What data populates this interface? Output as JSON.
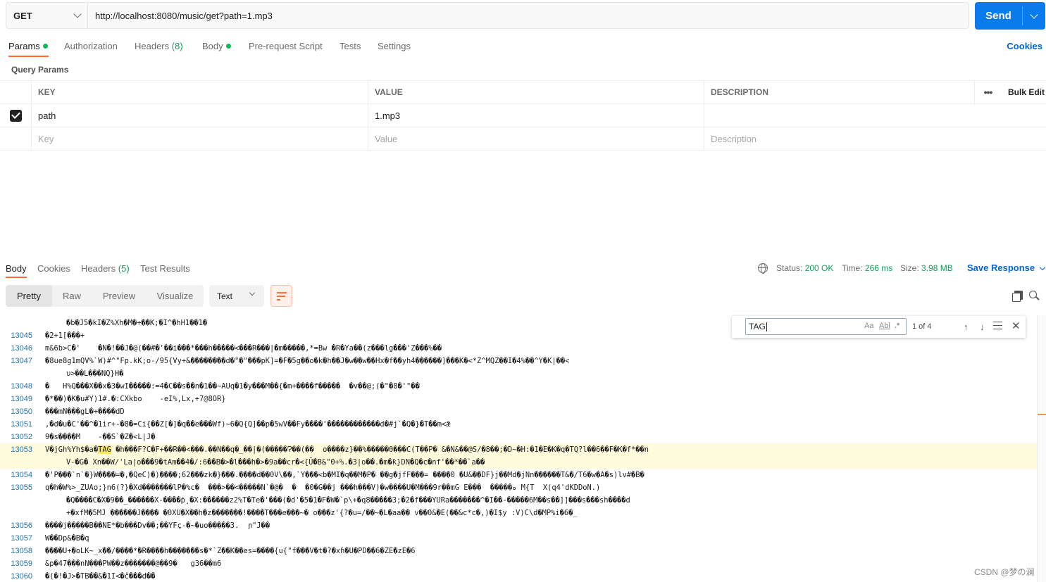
{
  "request": {
    "method": "GET",
    "url": "http://localhost:8080/music/get?path=1.mp3",
    "send_label": "Send"
  },
  "tabs": {
    "params": "Params",
    "authorization": "Authorization",
    "headers": "Headers",
    "headers_count": "(8)",
    "body": "Body",
    "pre_request": "Pre-request Script",
    "tests": "Tests",
    "settings": "Settings",
    "cookies": "Cookies"
  },
  "query_params": {
    "title": "Query Params",
    "headers": {
      "key": "KEY",
      "value": "VALUE",
      "description": "DESCRIPTION",
      "bulk_edit": "Bulk Edit"
    },
    "rows": [
      {
        "key": "path",
        "value": "1.mp3",
        "checked": true
      }
    ],
    "placeholders": {
      "key": "Key",
      "value": "Value",
      "description": "Description"
    }
  },
  "response": {
    "tabs": {
      "body": "Body",
      "cookies": "Cookies",
      "headers": "Headers",
      "headers_count": "(5)",
      "test_results": "Test Results"
    },
    "status_label": "Status:",
    "status_value": "200 OK",
    "time_label": "Time:",
    "time_value": "266 ms",
    "size_label": "Size:",
    "size_value": "3.98 MB",
    "save_label": "Save Response",
    "formats": {
      "pretty": "Pretty",
      "raw": "Raw",
      "preview": "Preview",
      "visualize": "Visualize"
    },
    "type_select": "Text"
  },
  "find": {
    "query": "TAG",
    "match_case": "Aa",
    "whole_word": "Abl",
    "regex": ".*",
    "count": "1 of 4"
  },
  "code_lines": [
    {
      "num": "",
      "text": "�b�J5�kI�Z%Xh�M�+��K;�I^�hH1��1�",
      "cont": true
    },
    {
      "num": "13045",
      "text": "�2+1[���+"
    },
    {
      "num": "13046",
      "text": "m&6b>C�'    �N�!��J�@(��#�'��i���*���h�����<���R���|�m�����,*=Bw �R�Ya��(z���lg���'Z���%��"
    },
    {
      "num": "13047",
      "text": "�8ue8g1mQV%`W)#^\"Fp.kK;o-/95{Vy+&��������d�\"�\"���pK]=�F�5g��o�k�h��J�w��w��Hx�f��yh4������]���K�<*Z^MQZ��I�4%��^Y�K|��<"
    },
    {
      "num": "",
      "text": "υ>��L���NQ}H�",
      "cont": true
    },
    {
      "num": "13048",
      "text": "�   H%Q���X��x�3�wI�����:=4�C��s��n�1��~AUq�1�y���M��{�m+����f�����  �v��@;(�\"�8�'\"��"
    },
    {
      "num": "13049",
      "text": "�*��)�K�u#Y)1#.�:CXkbo    -eI%,Lx,+7@8OR}"
    },
    {
      "num": "13050",
      "text": "���mN���gL�+����dD"
    },
    {
      "num": "13051",
      "text": ",�d�u�C'��^�1ir+-�8�=Ci{��Z[�]�q��e���Wf)~6�Q{Q]��p�5wV��Fy����'������������d�#j`�Q�}�T��m<ǣ"
    },
    {
      "num": "13052",
      "text": "9�s����M    -��S`�Z�<L|J�"
    },
    {
      "num": "13053",
      "text": "V�jGh%Yh$�a�TAG �h���F?C�F+��R��<���.��N��q�_��|�(�����Ɂ��(��  o����z}��%�����0���C(T��P� &�N&��@S/�8��;�D~�H:�1�E�K�q�TQ?l��6��F�K�f*��n",
      "hl": true,
      "match": "TAG"
    },
    {
      "num": "",
      "text": "V-�G� Xn��W/'La|o���9�tAm��4�/:6��B�>�l���h�>�9a��cr�<{Ṻ�B&\"0+%.�3|o��.�m�ƙ}DN�Q�c�nf'��*��`a��",
      "cont": true,
      "hl": true
    },
    {
      "num": "13054",
      "text": "�'P���`n`�}W����=�,�QeC)�)����;62���zk�}���.����d��0V\\��,`Y���<b�MI�q��M�P� ��g�jfF���= ����0 �U&��DF}j��Md�jNn������T&�/T6�w�A�s)lv#�B�"
    },
    {
      "num": "13055",
      "text": "q�h�W%>_ZUAo;}n6(?}�Xd�������lP�%c�  ���>��<�����N`�@�  �  �0�G��j ���h���V)�w����U�M���9r��mG E���  �����ه M{T  X(q4'dKDDoN.)"
    },
    {
      "num": "",
      "text": "�Q����C�X�9��_������X-����ṗ¸�X:������z2%T�Te�'���(�d'�5�1�F�W�`p\\+�q8�����3;�2�f���YURa�������^�I��-�����6M��s��]]���s���sh����d",
      "cont": true
    },
    {
      "num": "",
      "text": "+�xfM�5MJ ������J���� �0XU�X��h�z�������!����T���e���~� o���z'{?�u=/��~�L�aa�� v��0&�E(��&c*c�,)�I$y :V)C\\d�MP%i�6�_",
      "cont": true
    },
    {
      "num": "13056",
      "text": "����j�����B��NE*�b���Dv��;��YFç-�~�uo�����3.  ɲ\"J��"
    },
    {
      "num": "13057",
      "text": "W��Dp&�B�q"
    },
    {
      "num": "13058",
      "text": "����U+�oLK~_x��/����*�R����h�������s�*`Z��K��es=����{u{\"f���V�t�?�xɦ�U�PD��6�ZE�zE�6"
    },
    {
      "num": "13059",
      "text": "&p�47���nN���PW��z�������@��9�   g36��m6"
    },
    {
      "num": "13060",
      "text": "�(�!�J>�TB��&�1I<�ĉ���d��"
    }
  ],
  "watermark": "CSDN @梦の澜"
}
